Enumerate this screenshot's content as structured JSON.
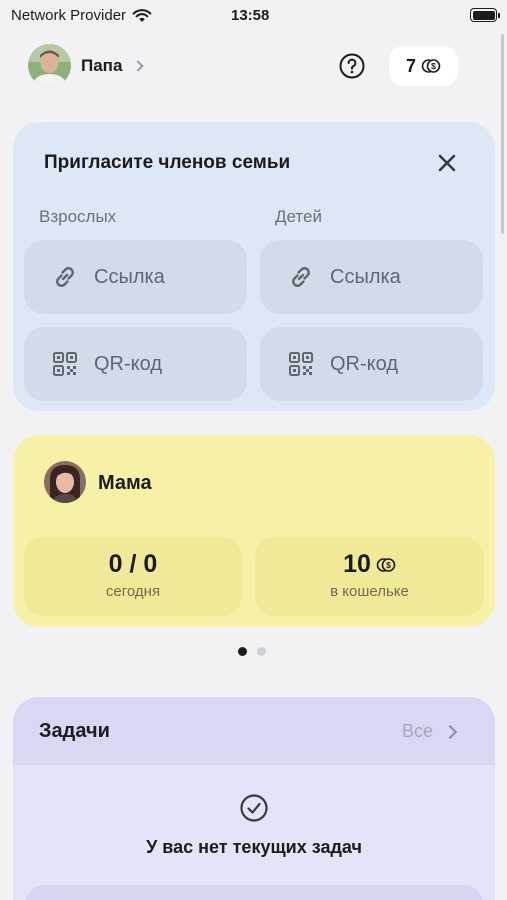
{
  "status_bar": {
    "carrier": "Network Provider",
    "time": "13:58"
  },
  "header": {
    "user_name": "Папа",
    "coins": "7"
  },
  "invite": {
    "title": "Пригласите членов семьи",
    "adults_label": "Взрослых",
    "kids_label": "Детей",
    "link_label": "Ссылка",
    "qr_label": "QR-код"
  },
  "member": {
    "name": "Мама",
    "today_value": "0 / 0",
    "today_label": "сегодня",
    "wallet_value": "10",
    "wallet_label": "в кошельке"
  },
  "pager": {
    "count": 2,
    "active": 0
  },
  "tasks": {
    "title": "Задачи",
    "all_label": "Все",
    "empty_text": "У вас нет текущих задач"
  },
  "colors": {
    "invite_bg": "#dde8f6",
    "member_bg": "#f6f1a6",
    "tasks_bg": "#e3e3fa"
  }
}
